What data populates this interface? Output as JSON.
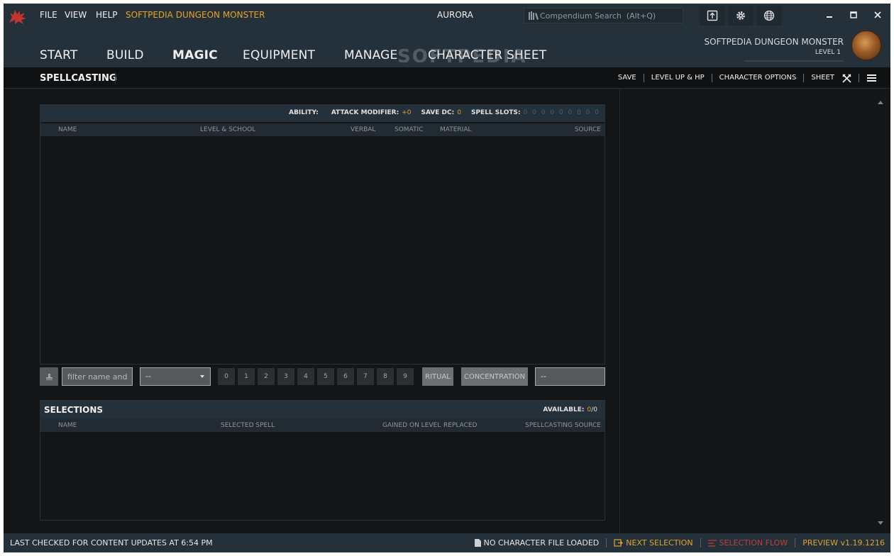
{
  "menu": {
    "file": "FILE",
    "view": "VIEW",
    "help": "HELP",
    "character_link": "SOFTPEDIA DUNGEON MONSTER"
  },
  "app_title": "AURORA",
  "search": {
    "placeholder": "Compendium Search  (Alt+Q)"
  },
  "nav": {
    "tabs": [
      "START",
      "BUILD",
      "MAGIC",
      "EQUIPMENT",
      "MANAGE",
      "CHARACTER SHEET"
    ],
    "active": "MAGIC"
  },
  "watermark": "SOFTPEDIA",
  "character": {
    "name": "SOFTPEDIA DUNGEON MONSTER",
    "level": "LEVEL 1"
  },
  "subbar": {
    "title": "SPELLCASTING",
    "actions": {
      "save": "SAVE",
      "level_up": "LEVEL UP & HP",
      "options": "CHARACTER OPTIONS",
      "sheet": "SHEET"
    }
  },
  "spells": {
    "stats": {
      "ability_label": "ABILITY:",
      "ability_value": "",
      "attack_label": "ATTACK MODIFIER:",
      "attack_value": "+0",
      "save_label": "SAVE DC:",
      "save_value": "0",
      "slots_label": "SPELL SLOTS:",
      "slots_value": "0 0 0 0 0 0 0 0 0"
    },
    "columns": {
      "name": "NAME",
      "level_school": "LEVEL & SCHOOL",
      "verbal": "VERBAL",
      "somatic": "SOMATIC",
      "material": "MATERIAL",
      "source": "SOURCE"
    }
  },
  "filters": {
    "name_placeholder": "filter name and",
    "level_select": "--",
    "levels": [
      "0",
      "1",
      "2",
      "3",
      "4",
      "5",
      "6",
      "7",
      "8",
      "9"
    ],
    "ritual": "RITUAL",
    "concentration": "CONCENTRATION",
    "source_select": "--"
  },
  "selections": {
    "title": "SELECTIONS",
    "available_label": "AVAILABLE:",
    "available_value": "0",
    "available_sep": "/",
    "available_total": "0",
    "columns": {
      "name": "NAME",
      "selected_spell": "SELECTED SPELL",
      "gained_on_level": "GAINED ON LEVEL",
      "replaced": "REPLACED",
      "source": "SPELLCASTING SOURCE"
    }
  },
  "status": {
    "left": "LAST CHECKED FOR CONTENT UPDATES AT 6:54 PM",
    "file": "NO CHARACTER FILE LOADED",
    "next": "NEXT SELECTION",
    "flow": "SELECTION FLOW",
    "version": "PREVIEW v1.19.1216"
  },
  "colors": {
    "accent": "#e2a32b",
    "header_bg": "#25313a",
    "panel_bg": "#141516",
    "flow_red": "#c23b32"
  }
}
